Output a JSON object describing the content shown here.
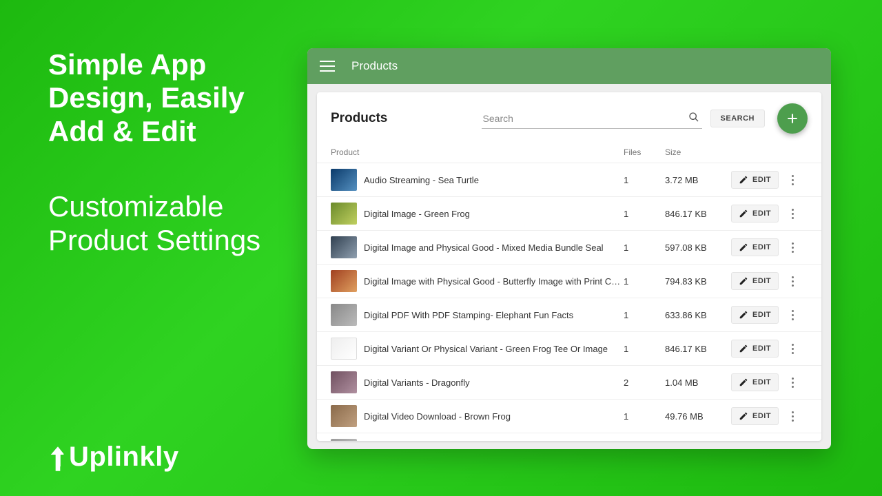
{
  "promo": {
    "heading1": "Simple App Design, Easily Add & Edit",
    "heading2": "Customizable Product Settings"
  },
  "brand": {
    "name": "Uplinkly"
  },
  "appbar": {
    "title": "Products"
  },
  "card": {
    "title": "Products",
    "search_placeholder": "Search",
    "search_button": "SEARCH"
  },
  "columns": {
    "product": "Product",
    "files": "Files",
    "size": "Size"
  },
  "edit_label": "EDIT",
  "products": [
    {
      "name": "Audio Streaming - Sea Turtle",
      "files": "1",
      "size": "3.72 MB"
    },
    {
      "name": "Digital Image - Green Frog",
      "files": "1",
      "size": "846.17 KB"
    },
    {
      "name": "Digital Image and Physical Good - Mixed Media Bundle Seal",
      "files": "1",
      "size": "597.08 KB"
    },
    {
      "name": "Digital Image with Physical Good - Butterfly Image with Print Canvas",
      "files": "1",
      "size": "794.83 KB"
    },
    {
      "name": "Digital PDF With PDF Stamping- Elephant Fun Facts",
      "files": "1",
      "size": "633.86 KB"
    },
    {
      "name": "Digital Variant Or Physical Variant - Green Frog Tee Or Image",
      "files": "1",
      "size": "846.17 KB"
    },
    {
      "name": "Digital Variants - Dragonfly",
      "files": "2",
      "size": "1.04 MB"
    },
    {
      "name": "Digital Video Download - Brown Frog",
      "files": "1",
      "size": "49.76 MB"
    },
    {
      "name": "",
      "files": "",
      "size": ""
    }
  ]
}
